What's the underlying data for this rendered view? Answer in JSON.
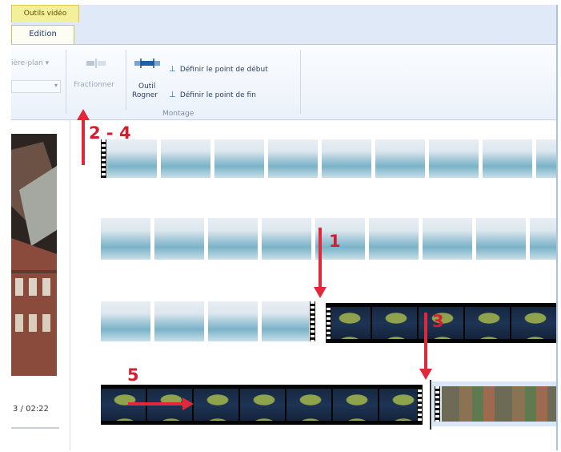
{
  "ribbon": {
    "context_tab": "Outils vidéo",
    "active_tab": "Edition",
    "background_color_dropdown": "ière-plan",
    "split_button": "Fractionner",
    "trim_tool_line1": "Outil",
    "trim_tool_line2": "Rogner",
    "set_start_point": "Définir le point de début",
    "set_end_point": "Définir le point de fin",
    "group_label": "Montage"
  },
  "preview": {
    "time": "3 / 02:22"
  },
  "annotations": {
    "step_2_4": "2 - 4",
    "step_1": "1",
    "step_3": "3",
    "step_5": "5"
  },
  "colors": {
    "annotation_red": "#e0283a",
    "ribbon_blue": "#dfe9f7",
    "context_yellow": "#f3ef9a"
  }
}
